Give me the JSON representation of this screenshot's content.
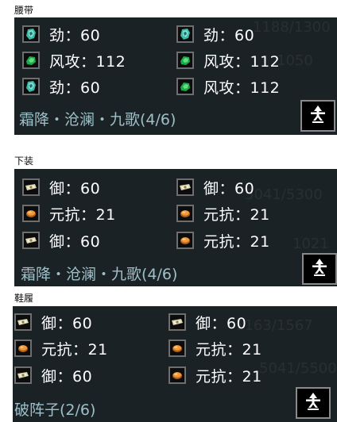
{
  "sections": [
    {
      "label": "腰带",
      "rows": [
        {
          "left": {
            "icon": "teal-crystal-icon",
            "text": "劲：60"
          },
          "right": {
            "icon": "teal-crystal-icon",
            "text": "劲：60"
          }
        },
        {
          "left": {
            "icon": "green-gem-icon",
            "text": "风攻：112"
          },
          "right": {
            "icon": "green-gem-icon",
            "text": "风攻：112"
          }
        },
        {
          "left": {
            "icon": "teal-crystal-icon",
            "text": "劲：60"
          },
          "right": {
            "icon": "green-gem-icon",
            "text": "风攻：112"
          }
        }
      ],
      "set_name": "霜降・沧澜・九歌(4/6)"
    },
    {
      "label": "下装",
      "rows": [
        {
          "left": {
            "icon": "scroll-icon",
            "text": "御：60"
          },
          "right": {
            "icon": "scroll-icon",
            "text": "御：60"
          }
        },
        {
          "left": {
            "icon": "orange-orb-icon",
            "text": "元抗：21"
          },
          "right": {
            "icon": "orange-orb-icon",
            "text": "元抗：21"
          }
        },
        {
          "left": {
            "icon": "scroll-icon",
            "text": "御：60"
          },
          "right": {
            "icon": "orange-orb-icon",
            "text": "元抗：21"
          }
        }
      ],
      "set_name": "霜降・沧澜・九歌(4/6)"
    },
    {
      "label": "鞋履",
      "rows": [
        {
          "left": {
            "icon": "scroll-icon",
            "text": "御：60"
          },
          "right": {
            "icon": "scroll-icon",
            "text": "御：60"
          }
        },
        {
          "left": {
            "icon": "orange-orb-icon",
            "text": "元抗：21"
          },
          "right": {
            "icon": "orange-orb-icon",
            "text": "元抗：21"
          }
        },
        {
          "left": {
            "icon": "scroll-icon",
            "text": "御：60"
          },
          "right": {
            "icon": "orange-orb-icon",
            "text": "元抗：21"
          }
        }
      ],
      "set_name": "破阵子(2/6)"
    }
  ],
  "colors": {
    "panel_bg": "#1b2226",
    "stat_text": "#ffffff",
    "set_name_text": "#9dc0c8",
    "button_border": "#8a8a8a"
  }
}
